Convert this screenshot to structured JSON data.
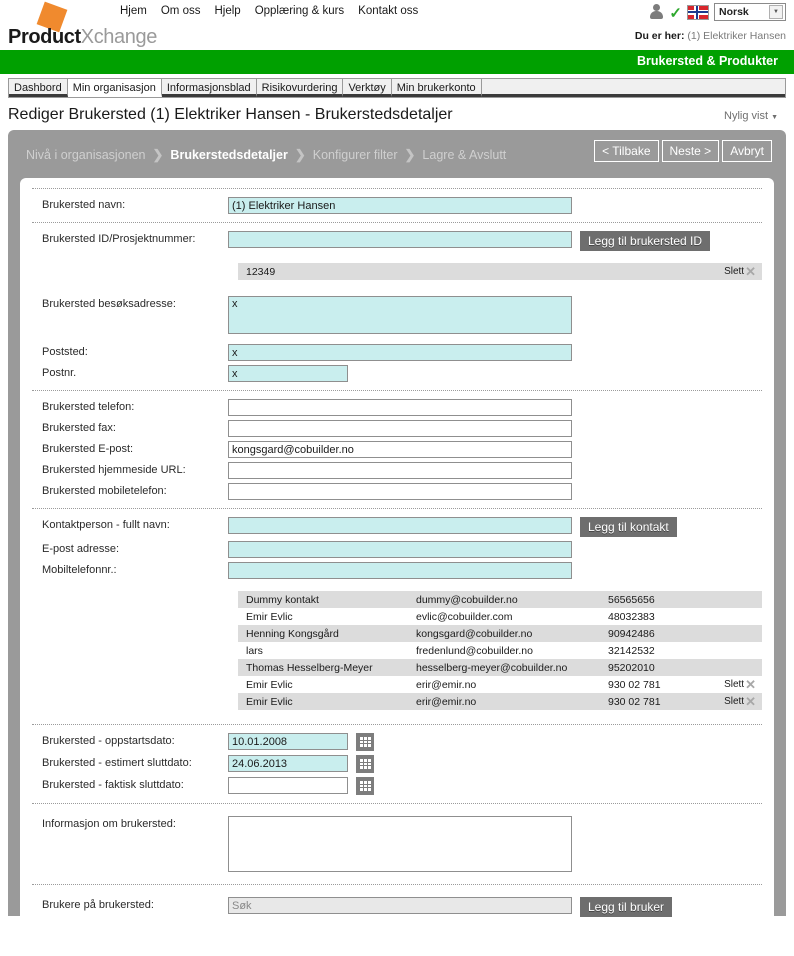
{
  "header": {
    "logo_bold": "Product",
    "logo_light": "Xchange",
    "nav": [
      {
        "label": "Hjem"
      },
      {
        "label": "Om oss"
      },
      {
        "label": "Hjelp"
      },
      {
        "label": "Opplæring & kurs"
      },
      {
        "label": "Kontakt oss"
      }
    ],
    "language": "Norsk",
    "breadcrumb_label": "Du er her:",
    "breadcrumb_value": "(1) Elektriker Hansen",
    "green_bar_title": "Brukersted & Produkter",
    "accent_green": "#00a000",
    "accent_orange": "#f08a2e"
  },
  "tabs": [
    {
      "label": "Dashbord",
      "active": false
    },
    {
      "label": "Min organisasjon",
      "active": true
    },
    {
      "label": "Informasjonsblad",
      "active": false
    },
    {
      "label": "Risikovurdering",
      "active": false
    },
    {
      "label": "Verktøy",
      "active": false
    },
    {
      "label": "Min brukerkonto",
      "active": false
    }
  ],
  "page": {
    "title": "Rediger Brukersted (1) Elektriker Hansen - Brukerstedsdetaljer",
    "recent_label": "Nylig vist"
  },
  "wizard": {
    "steps": [
      {
        "label": "Nivå i organisasjonen",
        "active": false
      },
      {
        "label": "Brukerstedsdetaljer",
        "active": true
      },
      {
        "label": "Konfigurer filter",
        "active": false
      },
      {
        "label": "Lagre & Avslutt",
        "active": false
      }
    ],
    "buttons": {
      "back": "< Tilbake",
      "next": "Neste >",
      "cancel": "Avbryt"
    }
  },
  "form": {
    "site_name": {
      "label": "Brukersted navn:",
      "value": "(1) Elektriker Hansen"
    },
    "site_id": {
      "label": "Brukersted ID/Prosjektnummer:",
      "value": "",
      "button": "Legg til brukersted ID"
    },
    "site_id_rows": [
      {
        "value": "12349",
        "delete_label": "Slett"
      }
    ],
    "visit_address": {
      "label": "Brukersted besøksadresse:",
      "value": "x"
    },
    "postal_place": {
      "label": "Poststed:",
      "value": "x"
    },
    "postal_code": {
      "label": "Postnr.",
      "value": "x"
    },
    "phone": {
      "label": "Brukersted telefon:",
      "value": ""
    },
    "fax": {
      "label": "Brukersted fax:",
      "value": ""
    },
    "email": {
      "label": "Brukersted E-post:",
      "value": "kongsgard@cobuilder.no"
    },
    "website": {
      "label": "Brukersted hjemmeside URL:",
      "value": ""
    },
    "mobile": {
      "label": "Brukersted mobiletelefon:",
      "value": ""
    },
    "contact_name": {
      "label": "Kontaktperson - fullt navn:",
      "value": "",
      "button": "Legg til kontakt"
    },
    "contact_email": {
      "label": "E-post adresse:",
      "value": ""
    },
    "contact_mobile": {
      "label": "Mobiltelefonnr.:",
      "value": ""
    },
    "contacts": [
      {
        "name": "Dummy kontakt",
        "email": "dummy@cobuilder.no",
        "phone": "56565656",
        "delete_label": ""
      },
      {
        "name": "Emir Evlic",
        "email": "evlic@cobuilder.com",
        "phone": "48032383",
        "delete_label": ""
      },
      {
        "name": "Henning Kongsgård",
        "email": "kongsgard@cobuilder.no",
        "phone": "90942486",
        "delete_label": ""
      },
      {
        "name": "lars",
        "email": "fredenlund@cobuilder.no",
        "phone": "32142532",
        "delete_label": ""
      },
      {
        "name": "Thomas Hesselberg-Meyer",
        "email": "hesselberg-meyer@cobuilder.no",
        "phone": "95202010",
        "delete_label": ""
      },
      {
        "name": "Emir Evlic",
        "email": "erir@emir.no",
        "phone": "930 02 781",
        "delete_label": "Slett"
      },
      {
        "name": "Emir Evlic",
        "email": "erir@emir.no",
        "phone": "930 02 781",
        "delete_label": "Slett"
      }
    ],
    "start_date": {
      "label": "Brukersted - oppstartsdato:",
      "value": "10.01.2008"
    },
    "estimated_end_date": {
      "label": "Brukersted - estimert sluttdato:",
      "value": "24.06.2013"
    },
    "actual_end_date": {
      "label": "Brukersted - faktisk sluttdato:",
      "value": ""
    },
    "info": {
      "label": "Informasjon om brukersted:",
      "value": ""
    },
    "users": {
      "label": "Brukere på brukersted:",
      "value": "",
      "placeholder": "Søk",
      "button": "Legg til bruker"
    }
  }
}
